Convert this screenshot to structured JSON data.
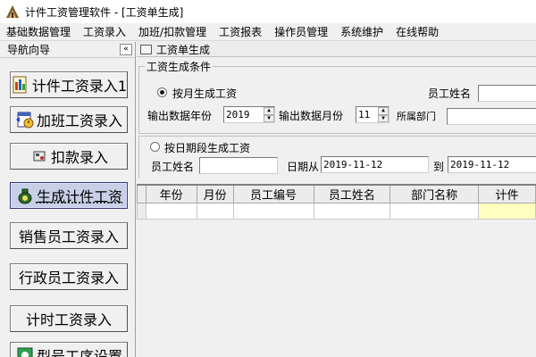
{
  "window": {
    "title": "计件工资管理软件 - [工资单生成]"
  },
  "menu": [
    "基础数据管理",
    "工资录入",
    "加班/扣款管理",
    "工资报表",
    "操作员管理",
    "系统维护",
    "在线帮助"
  ],
  "nav": {
    "title": "导航向导",
    "collapse_label": "«",
    "items": [
      {
        "label": "计件工资录入1",
        "icon": "report-doc-icon"
      },
      {
        "label": "加班工资录入",
        "icon": "calendar-clock-icon"
      },
      {
        "label": "扣款录入",
        "icon": "deduct-icon"
      },
      {
        "label": "生成计件工资",
        "icon": "money-bag-icon",
        "active": true
      },
      {
        "label": "销售员工资录入",
        "icon": ""
      },
      {
        "label": "行政员工资录入",
        "icon": ""
      },
      {
        "label": "计时工资录入",
        "icon": ""
      },
      {
        "label": "型号工序设置",
        "icon": "settings-icon"
      }
    ]
  },
  "child_window": {
    "title": "工资单生成"
  },
  "form": {
    "group_title": "工资生成条件",
    "radio_month_label": "按月生成工资",
    "radio_month_selected": true,
    "employee_name_label": "员工姓名",
    "employee_name_value": "",
    "year_label": "输出数据年份",
    "year_value": "2019",
    "month_label": "输出数据月份",
    "month_value": "11",
    "dept_label": "所属部门",
    "dept_value": "",
    "radio_date_label": "按日期段生成工资",
    "radio_date_selected": false,
    "employee_name2_label": "员工姓名",
    "employee_name2_value": "",
    "date_from_label": "日期从",
    "date_from_value": "2019-11-12",
    "date_to_label": "到",
    "date_to_value": "2019-11-12"
  },
  "grid": {
    "columns": [
      "",
      "年份",
      "月份",
      "员工编号",
      "员工姓名",
      "部门名称",
      "计件"
    ]
  },
  "colors": {
    "active_nav": "#c8d0e8",
    "grid_highlight": "#ffffc0"
  }
}
